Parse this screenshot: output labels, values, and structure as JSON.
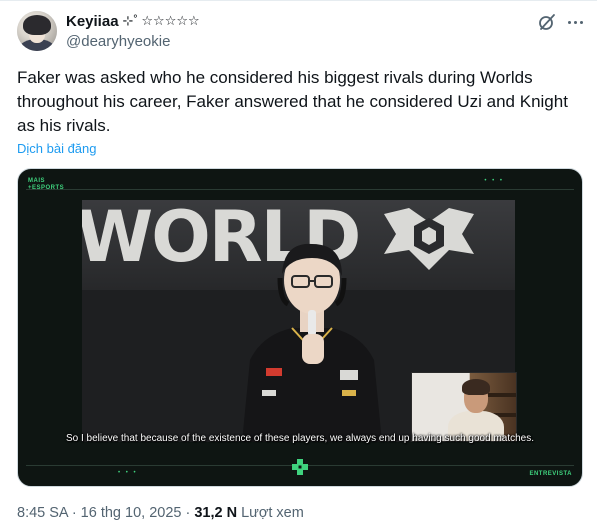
{
  "tweet": {
    "author": {
      "display_name": "Keyiiaa",
      "name_decoration": "⊹˚ ☆☆☆☆☆",
      "handle": "@dearyhyeokie"
    },
    "text": "Faker was asked who he considered his biggest rivals during Worlds throughout his career, Faker answered that he considered Uzi and Knight as his rivals.",
    "translate_label": "Dịch bài đăng",
    "timestamp": "8:45 SA · 16 thg 10, 2025 ·",
    "views_count": "31,2 N",
    "views_label": "Lượt xem"
  },
  "media": {
    "brand_top": "MAIS\n+ESPORTS",
    "brand_dots": "• • •",
    "stage_text": "WORLD",
    "segment_label": "ENTREVISTA",
    "subtitle": "So I believe that because of the existence of these players, we always end up having such good matches."
  },
  "icons": {
    "grok": "grok-icon",
    "more": "more-options-icon",
    "media_logo": "plus-cross-logo-icon"
  },
  "colors": {
    "text_primary": "#0f1419",
    "text_secondary": "#536471",
    "link": "#1d9bf0",
    "brand_green": "#3fd27e"
  }
}
